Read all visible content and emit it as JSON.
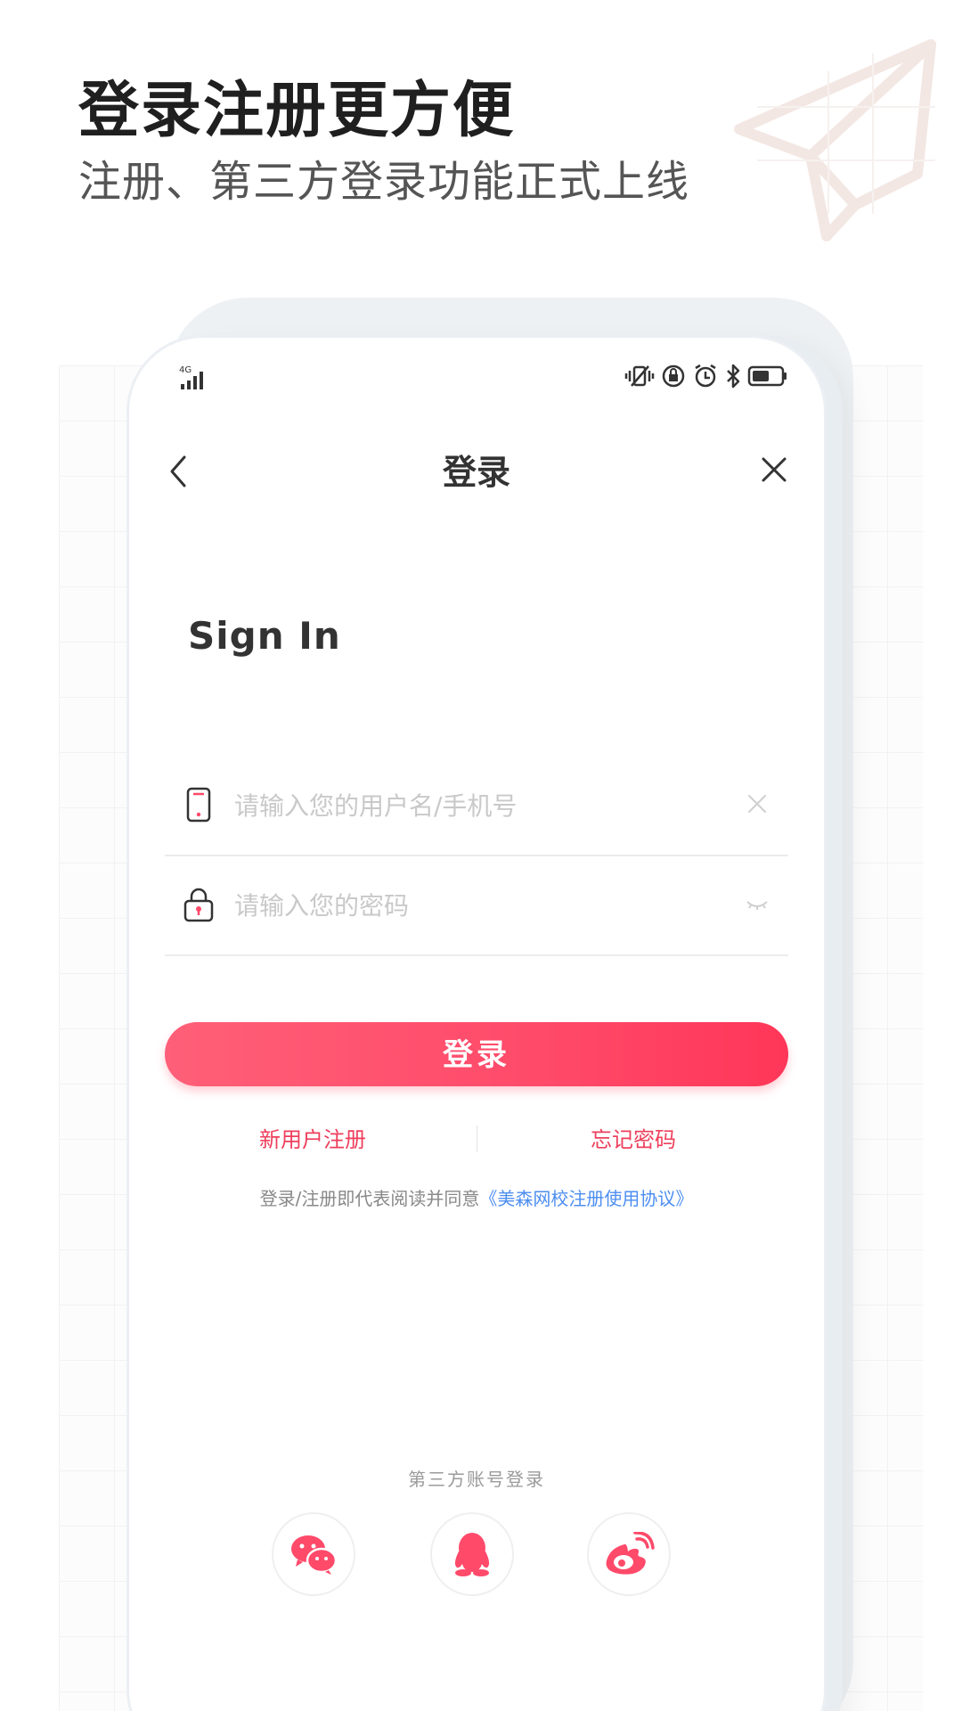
{
  "promo": {
    "headline": "登录注册更方便",
    "subheadline": "注册、第三方登录功能正式上线"
  },
  "status_bar": {
    "network": "4G",
    "icons": [
      "vibrate-icon",
      "rotation-lock-icon",
      "alarm-icon",
      "bluetooth-icon",
      "battery-icon"
    ]
  },
  "nav": {
    "title": "登录"
  },
  "form": {
    "title": "Sign In",
    "username_placeholder": "请输入您的用户名/手机号",
    "password_placeholder": "请输入您的密码",
    "login_label": "登录"
  },
  "links": {
    "register": "新用户注册",
    "forgot": "忘记密码"
  },
  "agreement": {
    "prefix": "登录/注册即代表阅读并同意",
    "link_text": "《美森网校注册使用协议》"
  },
  "third_party": {
    "title": "第三方账号登录",
    "providers": [
      "wechat-icon",
      "qq-icon",
      "weibo-icon"
    ]
  },
  "colors": {
    "accent": "#ff4a6a",
    "link_blue": "#4d8ef1",
    "text_dark": "#333333",
    "placeholder": "#c9c9c9"
  }
}
